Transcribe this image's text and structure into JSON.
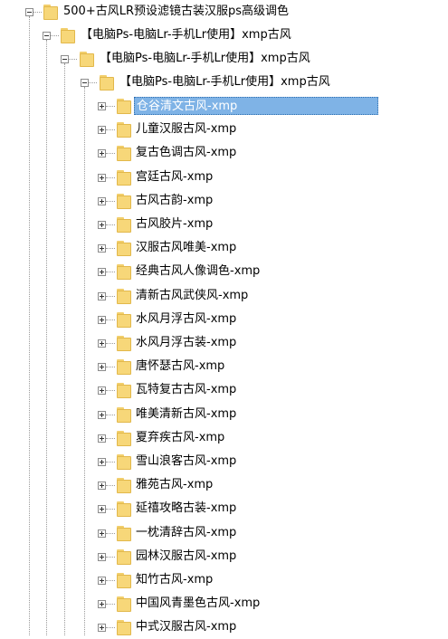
{
  "tree": {
    "root": {
      "label": "500+古风LR预设滤镜古装汉服ps高级调色",
      "expanded": true
    },
    "level1": {
      "label": "【电脑Ps-电脑Lr-手机Lr使用】xmp古风",
      "expanded": true
    },
    "level2": {
      "label": "【电脑Ps-电脑Lr-手机Lr使用】xmp古风",
      "expanded": true
    },
    "level3": {
      "label": "【电脑Ps-电脑Lr-手机Lr使用】xmp古风",
      "expanded": true
    },
    "items": [
      {
        "label": "仓谷清文古风-xmp",
        "selected": true
      },
      {
        "label": "儿童汉服古风-xmp"
      },
      {
        "label": "复古色调古风-xmp"
      },
      {
        "label": "宫廷古风-xmp"
      },
      {
        "label": "古风古韵-xmp"
      },
      {
        "label": "古风胶片-xmp"
      },
      {
        "label": "汉服古风唯美-xmp"
      },
      {
        "label": "经典古风人像调色-xmp"
      },
      {
        "label": "清新古风武侠风-xmp"
      },
      {
        "label": "水风月浮古风-xmp"
      },
      {
        "label": "水风月浮古装-xmp"
      },
      {
        "label": "唐怀瑟古风-xmp"
      },
      {
        "label": "瓦特复古古风-xmp"
      },
      {
        "label": "唯美清新古风-xmp"
      },
      {
        "label": "夏弃疾古风-xmp"
      },
      {
        "label": "雪山浪客古风-xmp"
      },
      {
        "label": "雅苑古风-xmp"
      },
      {
        "label": "延禧攻略古装-xmp"
      },
      {
        "label": "一枕清辞古风-xmp"
      },
      {
        "label": "园林汉服古风-xmp"
      },
      {
        "label": "知竹古风-xmp"
      },
      {
        "label": "中国风青墨色古风-xmp"
      },
      {
        "label": "中式汉服古风-xmp"
      }
    ]
  },
  "colors": {
    "selection": "#7fb3e6",
    "folder": "#f7d779",
    "line": "#9a9a9a"
  }
}
